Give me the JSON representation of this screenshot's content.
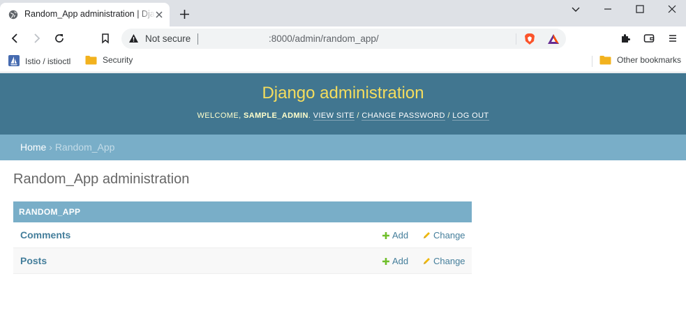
{
  "browser": {
    "tab_title": "Random_App administration | Django site admin",
    "address": {
      "security_label": "Not secure",
      "url": ":8000/admin/random_app/"
    },
    "bookmarks": [
      {
        "label": "Istio / istioctl",
        "icon": "istio-icon"
      },
      {
        "label": "Security",
        "icon": "folder-icon"
      }
    ],
    "other_bookmarks": "Other bookmarks"
  },
  "header": {
    "site_name": "Django administration",
    "welcome": "Welcome,",
    "username": "sample_admin",
    "view_site": "View site",
    "change_password": "Change password",
    "log_out": "Log out",
    "sep": "/"
  },
  "breadcrumbs": {
    "home": "Home",
    "separator": "›",
    "current": "Random_App"
  },
  "page_title": "Random_App administration",
  "module": {
    "caption": "Random_App",
    "models": [
      {
        "name": "Comments",
        "add": "Add",
        "change": "Change"
      },
      {
        "name": "Posts",
        "add": "Add",
        "change": "Change"
      }
    ]
  },
  "colors": {
    "header_bg": "#417690",
    "brand": "#f5dd5d",
    "breadcrumbs_bg": "#79aec8",
    "link": "#447e9b",
    "add_icon": "#70bf2b",
    "change_icon": "#efb80b"
  }
}
